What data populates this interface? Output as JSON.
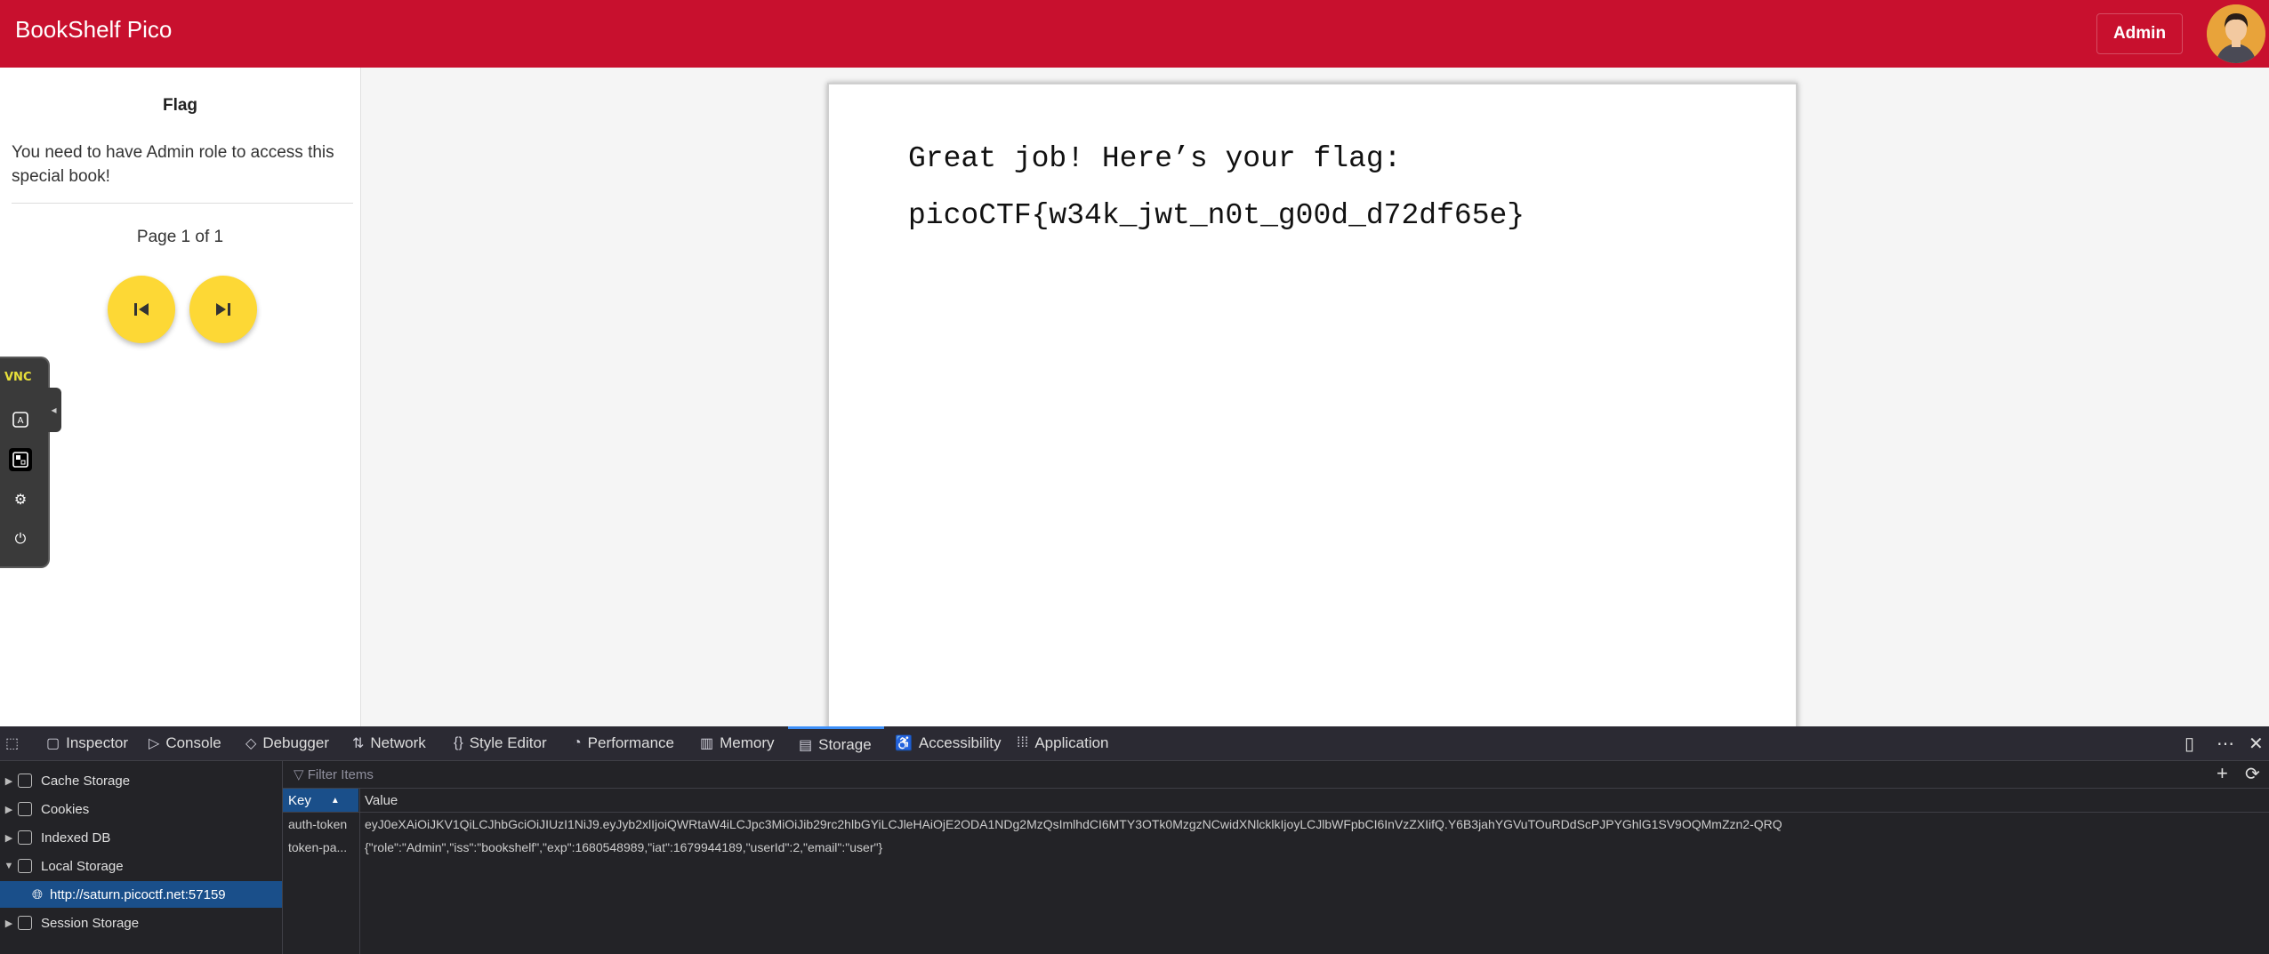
{
  "app": {
    "title": "BookShelf Pico",
    "user_button": "Admin",
    "colors": {
      "appbar": "#c8102e",
      "nav_button": "#fdd835",
      "devtools_bg": "#232327",
      "selection": "#1a4f8a"
    }
  },
  "sidebar": {
    "title": "Flag",
    "message": "You need to have Admin role to access this special book!",
    "page_label": "Page 1 of 1",
    "buttons": [
      {
        "icon": "skip-previous-icon"
      },
      {
        "icon": "skip-next-icon"
      }
    ]
  },
  "vnc_panel": {
    "logo": "VNC",
    "buttons": [
      "keyboard-icon",
      "fullscreen-icon",
      "gear-icon",
      "power-icon"
    ]
  },
  "book": {
    "line1": "Great job! Here’s your flag:",
    "line2": "picoCTF{w34k_jwt_n0t_g00d_d72df65e}"
  },
  "devtools": {
    "tabs": [
      {
        "label": "Inspector",
        "icon": "inspector-icon"
      },
      {
        "label": "Console",
        "icon": "console-icon"
      },
      {
        "label": "Debugger",
        "icon": "debugger-icon"
      },
      {
        "label": "Network",
        "icon": "network-icon"
      },
      {
        "label": "Style Editor",
        "icon": "style-editor-icon"
      },
      {
        "label": "Performance",
        "icon": "performance-icon"
      },
      {
        "label": "Memory",
        "icon": "memory-icon"
      },
      {
        "label": "Storage",
        "icon": "storage-icon",
        "active": true
      },
      {
        "label": "Accessibility",
        "icon": "accessibility-icon"
      },
      {
        "label": "Application",
        "icon": "application-icon"
      }
    ],
    "tree": [
      {
        "label": "Cache Storage",
        "expanded": false
      },
      {
        "label": "Cookies",
        "expanded": false
      },
      {
        "label": "Indexed DB",
        "expanded": false
      },
      {
        "label": "Local Storage",
        "expanded": true
      },
      {
        "label": "http://saturn.picoctf.net:57159",
        "selected": true
      },
      {
        "label": "Session Storage",
        "expanded": false
      }
    ],
    "filter_placeholder": "Filter Items",
    "columns": {
      "key": "Key",
      "value": "Value"
    },
    "rows": [
      {
        "key": "auth-token",
        "value": "eyJ0eXAiOiJKV1QiLCJhbGciOiJIUzI1NiJ9.eyJyb2xlIjoiQWRtaW4iLCJpc3MiOiJib29rc2hlbGYiLCJleHAiOjE2ODA1NDg2MzQsImlhdCI6MTY3OTk0MzgzNCwidXNlcklkIjoyLCJlbWFpbCI6InVzZXIifQ.Y6B3jahYGVuTOuRDdScPJPYGhlG1SV9OQMmZzn2-QRQ"
      },
      {
        "key": "token-pa...",
        "value": "{\"role\":\"Admin\",\"iss\":\"bookshelf\",\"exp\":1680548989,\"iat\":1679944189,\"userId\":2,\"email\":\"user\"}"
      }
    ]
  }
}
